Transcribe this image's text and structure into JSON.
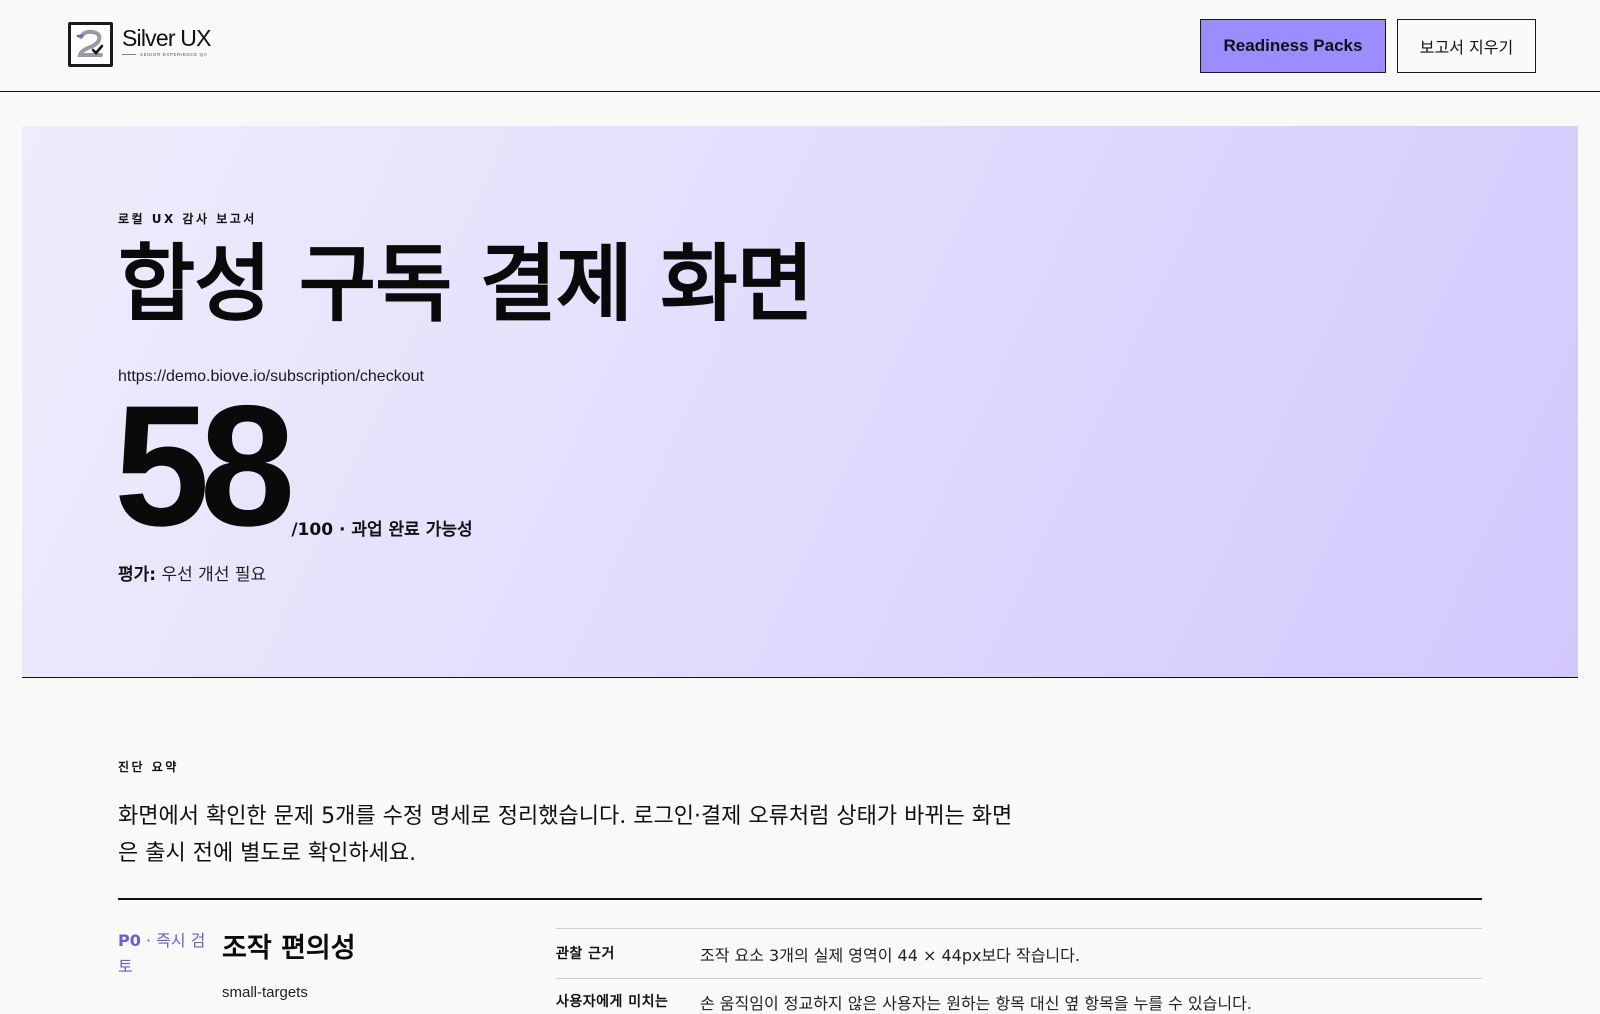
{
  "header": {
    "brand_name": "Silver UX",
    "brand_tagline": "SENIOR EXPERIENCE QA",
    "packs_button": "Readiness Packs",
    "clear_button": "보고서 지우기"
  },
  "hero": {
    "eyebrow": "로컬 UX 감사 보고서",
    "title": "합성 구독 결제 화면",
    "url": "https://demo.biove.io/subscription/checkout",
    "score": "58",
    "score_suffix": "/100 · 과업 완료 가능성",
    "rating_label": "평가:",
    "rating_value": "우선 개선 필요"
  },
  "summary": {
    "label": "진단 요약",
    "text": "화면에서 확인한 문제 5개를 수정 명세로 정리했습니다. 로그인·결제 오류처럼 상태가 바뀌는 화면은 출시 전에 별도로 확인하세요."
  },
  "issue": {
    "priority_code": "P0",
    "priority_rest": " · 즉시 검토",
    "title": "조작 편의성",
    "tag": "small-targets",
    "details": [
      {
        "label": "관찰 근거",
        "value": "조작 요소 3개의 실제 영역이 44 × 44px보다 작습니다."
      },
      {
        "label": "사용자에게 미치는",
        "value": "손 움직임이 정교하지 않은 사용자는 원하는 항목 대신 옆 항목을 누를 수 있습니다."
      }
    ]
  },
  "colors": {
    "accent": "#9b8cff",
    "priority": "#6a5ce0",
    "hero_gradient_start": "#efedfb",
    "hero_gradient_end": "#d3c8fd"
  }
}
